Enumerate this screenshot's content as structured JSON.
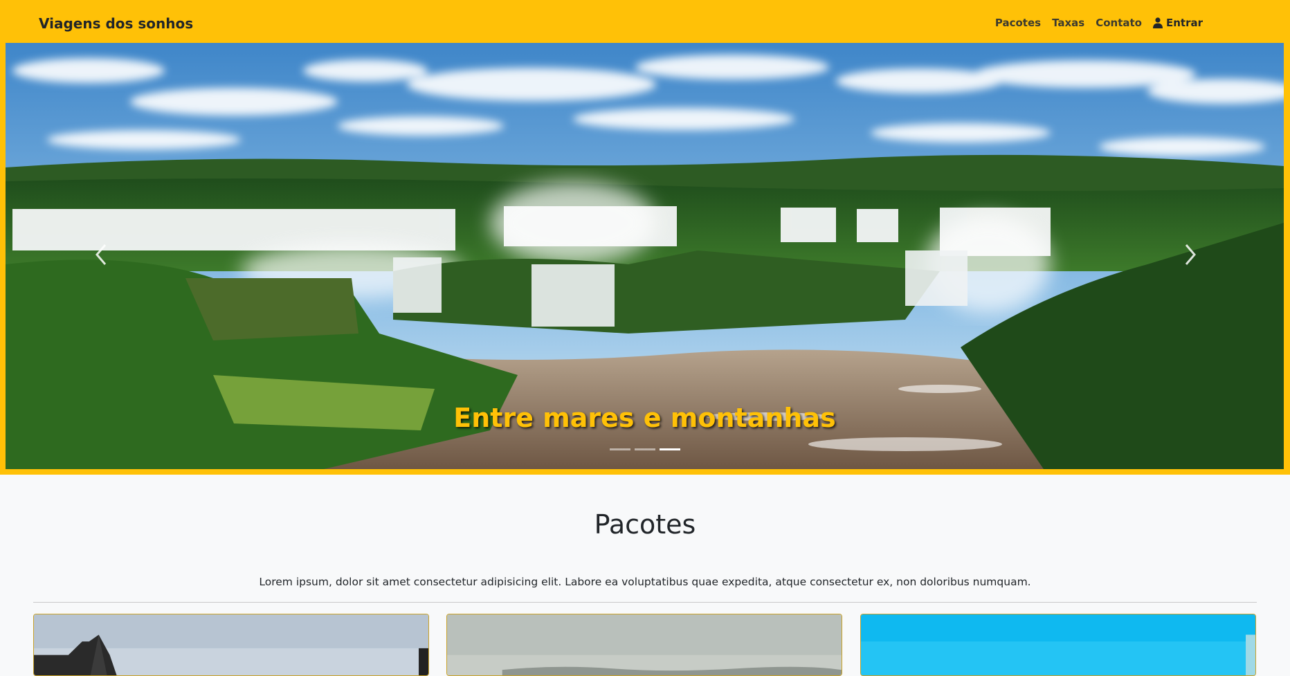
{
  "navbar": {
    "brand": "Viagens dos sonhos",
    "links": [
      "Pacotes",
      "Taxas",
      "Contato"
    ],
    "login_label": "Entrar"
  },
  "hero": {
    "caption": "Entre mares e montanhas",
    "indicators": 3,
    "active_indicator": 3
  },
  "packages": {
    "title": "Pacotes",
    "description": "Lorem ipsum, dolor sit amet consectetur adipisicing elit. Labore ea voluptatibus quae expedita, atque consectetur ex, non doloribus numquam."
  },
  "colors": {
    "accent": "#ffc107",
    "background": "#f8f9fa",
    "text": "#212529"
  }
}
